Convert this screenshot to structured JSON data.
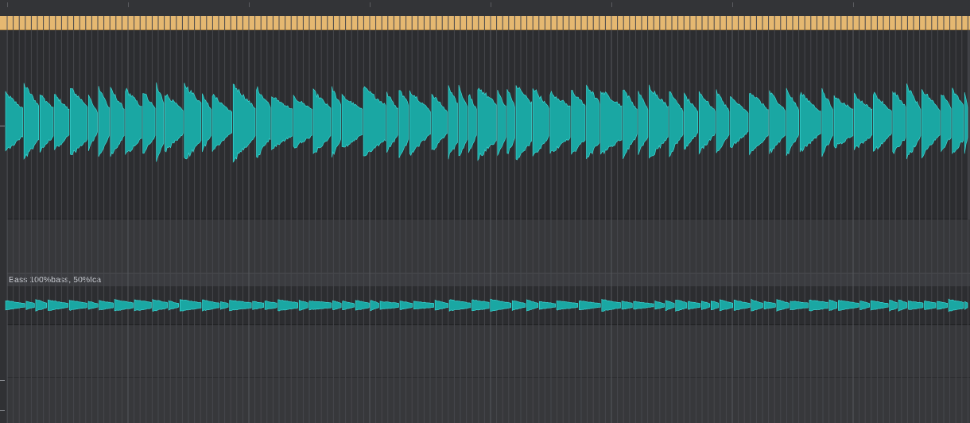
{
  "window": {
    "title": ""
  },
  "tracks": [
    {
      "name": "",
      "region_label": "",
      "waveform_color": "#1aa7a3"
    },
    {
      "name": "",
      "region_label": "Bass 100%bass, 50%fca",
      "waveform_color": "#1aa7a3"
    }
  ],
  "colors": {
    "cycle": "#e5b871",
    "background": "#37383b",
    "lane_dark": "#2c2d30",
    "grid": "#474850",
    "wave_outline": "#3fe0dc"
  }
}
